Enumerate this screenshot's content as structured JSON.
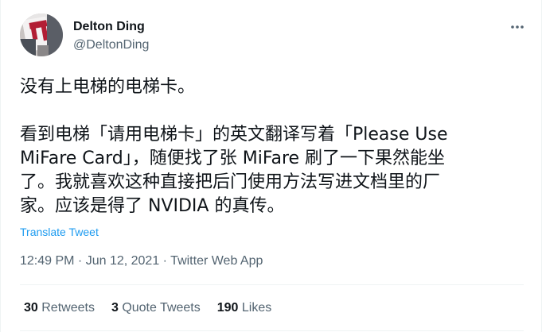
{
  "author": {
    "display_name": "Delton Ding",
    "handle": "@DeltonDing"
  },
  "tweet": {
    "paragraph_1": "没有上电梯的电梯卡。",
    "paragraph_2_lines": [
      "看到电梯「请用电梯卡」的英文翻译写着「Please Use",
      "MiFare Card」，随便找了张 MiFare 刷了一下果然能坐",
      "了。我就喜欢这种直接把后门使用方法写进文档里的厂",
      "家。应该是得了 NVIDIA 的真传。"
    ],
    "translate_label": "Translate Tweet",
    "time": "12:49 PM",
    "date": "Jun 12, 2021",
    "source": "Twitter Web App",
    "separator": " · "
  },
  "stats": {
    "retweets_count": "30",
    "retweets_label": "Retweets",
    "quotes_count": "3",
    "quotes_label": "Quote Tweets",
    "likes_count": "190",
    "likes_label": "Likes"
  },
  "icons": {
    "more": "more-horizontal-icon"
  },
  "colors": {
    "text": "#0f1419",
    "secondary": "#536471",
    "link": "#1d9bf0",
    "divider": "#eff3f4"
  }
}
